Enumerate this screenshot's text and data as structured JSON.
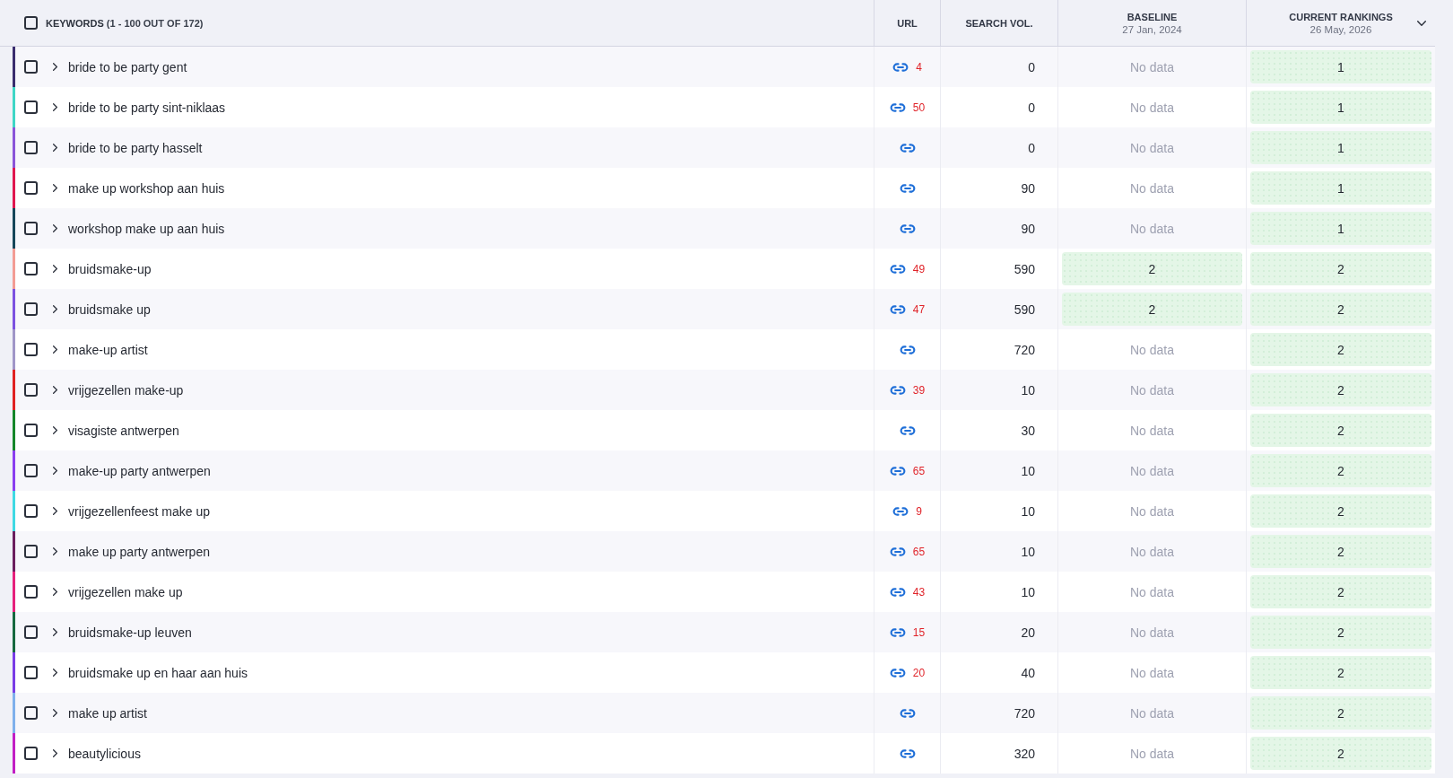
{
  "table": {
    "select_all": {
      "checked": false
    },
    "title": "**KEYWORDS** (1 - 100 OUT OF 172)",
    "columns": [
      {
        "label": "URL"
      },
      {
        "label": "SEARCH VOL."
      },
      {
        "label": "BASELINE",
        "date": "27 Jan, 2024"
      },
      {
        "label": "CURRENT RANKINGS",
        "date": "26 May, 2026",
        "menu": true
      }
    ],
    "rows": [
      {
        "keyword": "bride to be party gent",
        "color": "#3a2d6e",
        "checked": false,
        "expanded": false,
        "url_count": "4",
        "search_volume": "0",
        "baseline": {
          "kind": "empty",
          "text": "No data"
        },
        "current": {
          "kind": "rank",
          "text": "1"
        }
      },
      {
        "keyword": "bride to be party sint-niklaas",
        "color": "#3fd6c6",
        "checked": false,
        "expanded": false,
        "url_count": "50",
        "search_volume": "0",
        "baseline": {
          "kind": "empty",
          "text": "No data"
        },
        "current": {
          "kind": "rank",
          "text": "1"
        }
      },
      {
        "keyword": "bride to be party hasselt",
        "color": "#8b55d9",
        "checked": false,
        "expanded": false,
        "search_volume": "0",
        "baseline": {
          "kind": "empty",
          "text": "No data"
        },
        "current": {
          "kind": "rank",
          "text": "1"
        }
      },
      {
        "keyword": "make up workshop aan huis",
        "color": "#e0174f",
        "checked": false,
        "expanded": false,
        "search_volume": "90",
        "baseline": {
          "kind": "empty",
          "text": "No data"
        },
        "current": {
          "kind": "rank",
          "text": "1"
        }
      },
      {
        "keyword": "workshop make up aan huis",
        "color": "#17475a",
        "checked": false,
        "expanded": false,
        "search_volume": "90",
        "baseline": {
          "kind": "empty",
          "text": "No data"
        },
        "current": {
          "kind": "rank",
          "text": "1"
        }
      },
      {
        "keyword": "bruidsmake-up",
        "color": "#f39c94",
        "checked": false,
        "expanded": false,
        "url_count": "49",
        "search_volume": "590",
        "baseline": {
          "kind": "rank",
          "text": "2"
        },
        "current": {
          "kind": "rank",
          "text": "2"
        }
      },
      {
        "keyword": "bruidsmake up",
        "color": "#7c52e0",
        "checked": false,
        "expanded": false,
        "url_count": "47",
        "search_volume": "590",
        "baseline": {
          "kind": "rank",
          "text": "2"
        },
        "current": {
          "kind": "rank",
          "text": "2"
        }
      },
      {
        "keyword": "make-up artist",
        "color": "#a096c8",
        "checked": false,
        "expanded": false,
        "search_volume": "720",
        "baseline": {
          "kind": "empty",
          "text": "No data"
        },
        "current": {
          "kind": "rank",
          "text": "2"
        }
      },
      {
        "keyword": "vrijgezellen make-up",
        "color": "#e02222",
        "checked": false,
        "expanded": false,
        "url_count": "39",
        "search_volume": "10",
        "baseline": {
          "kind": "empty",
          "text": "No data"
        },
        "current": {
          "kind": "rank",
          "text": "2"
        }
      },
      {
        "keyword": "visagiste antwerpen",
        "color": "#15862a",
        "checked": false,
        "expanded": false,
        "search_volume": "30",
        "baseline": {
          "kind": "empty",
          "text": "No data"
        },
        "current": {
          "kind": "rank",
          "text": "2"
        }
      },
      {
        "keyword": "make-up party antwerpen",
        "color": "#8b3ff0",
        "checked": false,
        "expanded": false,
        "url_count": "65",
        "search_volume": "10",
        "baseline": {
          "kind": "empty",
          "text": "No data"
        },
        "current": {
          "kind": "rank",
          "text": "2"
        }
      },
      {
        "keyword": "vrijgezellenfeest make up",
        "color": "#3fd9e3",
        "checked": false,
        "expanded": false,
        "url_count": "9",
        "search_volume": "10",
        "baseline": {
          "kind": "empty",
          "text": "No data"
        },
        "current": {
          "kind": "rank",
          "text": "2"
        }
      },
      {
        "keyword": "make up party antwerpen",
        "color": "#6b1f5e",
        "checked": false,
        "expanded": false,
        "url_count": "65",
        "search_volume": "10",
        "baseline": {
          "kind": "empty",
          "text": "No data"
        },
        "current": {
          "kind": "rank",
          "text": "2"
        }
      },
      {
        "keyword": "vrijgezellen make up",
        "color": "#e6217c",
        "checked": false,
        "expanded": false,
        "url_count": "43",
        "search_volume": "10",
        "baseline": {
          "kind": "empty",
          "text": "No data"
        },
        "current": {
          "kind": "rank",
          "text": "2"
        }
      },
      {
        "keyword": "bruidsmake-up leuven",
        "color": "#17693f",
        "checked": false,
        "expanded": false,
        "url_count": "15",
        "search_volume": "20",
        "baseline": {
          "kind": "empty",
          "text": "No data"
        },
        "current": {
          "kind": "rank",
          "text": "2"
        }
      },
      {
        "keyword": "bruidsmake up en haar aan huis",
        "color": "#7a3ce6",
        "checked": false,
        "expanded": false,
        "url_count": "20",
        "search_volume": "40",
        "baseline": {
          "kind": "empty",
          "text": "No data"
        },
        "current": {
          "kind": "rank",
          "text": "2"
        }
      },
      {
        "keyword": "make up artist",
        "color": "#7fb0ec",
        "checked": false,
        "expanded": false,
        "search_volume": "720",
        "baseline": {
          "kind": "empty",
          "text": "No data"
        },
        "current": {
          "kind": "rank",
          "text": "2"
        }
      },
      {
        "keyword": "beautylicious",
        "color": "#c21fc4",
        "checked": false,
        "expanded": false,
        "search_volume": "320",
        "baseline": {
          "kind": "empty",
          "text": "No data"
        },
        "current": {
          "kind": "rank",
          "text": "2"
        }
      }
    ]
  }
}
